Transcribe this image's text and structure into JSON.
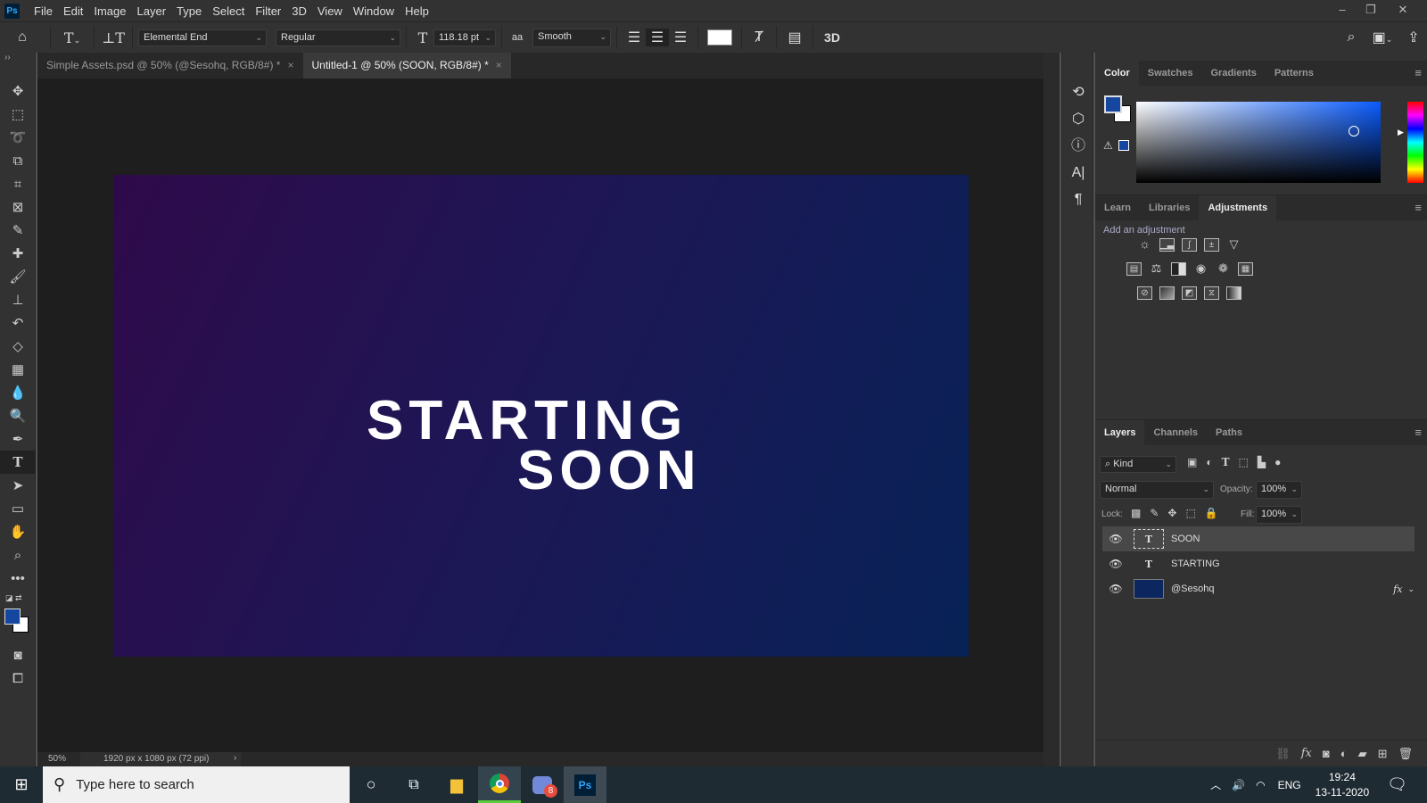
{
  "menubar": {
    "logo": "Ps",
    "items": [
      "File",
      "Edit",
      "Image",
      "Layer",
      "Type",
      "Select",
      "Filter",
      "3D",
      "View",
      "Window",
      "Help"
    ]
  },
  "options": {
    "font_family": "Elemental End",
    "font_style": "Regular",
    "font_size": "118.18 pt",
    "antialias": "Smooth",
    "aa_label": "aa",
    "three_d": "3D",
    "text_color": "#ffffff"
  },
  "tabs": [
    {
      "label": "Simple Assets.psd @ 50% (@Sesohq, RGB/8#) *"
    },
    {
      "label": "Untitled-1 @ 50% (SOON, RGB/8#) *"
    }
  ],
  "canvas": {
    "line1": "STARTING",
    "line2": "SOON"
  },
  "status": {
    "zoom": "50%",
    "doc_info": "1920 px x 1080 px (72 ppi)"
  },
  "color_panel": {
    "tabs": [
      "Color",
      "Swatches",
      "Gradients",
      "Patterns"
    ],
    "foreground": "#1547a0",
    "background": "#ffffff"
  },
  "adjust_panel": {
    "tabs": [
      "Learn",
      "Libraries",
      "Adjustments"
    ],
    "hint": "Add an adjustment"
  },
  "layers_panel": {
    "tabs": [
      "Layers",
      "Channels",
      "Paths"
    ],
    "filter": "Kind",
    "blend": "Normal",
    "opacity_label": "Opacity:",
    "opacity": "100%",
    "lock_label": "Lock:",
    "fill_label": "Fill:",
    "fill": "100%",
    "layers": [
      {
        "name": "SOON",
        "type": "text"
      },
      {
        "name": "STARTING",
        "type": "text"
      },
      {
        "name": "@Sesohq",
        "type": "fill",
        "fx": "fx"
      }
    ]
  },
  "taskbar": {
    "search_placeholder": "Type here to search",
    "lang": "ENG",
    "time": "19:24",
    "date": "13-11-2020",
    "discord_badge": "8",
    "ps": "Ps"
  }
}
